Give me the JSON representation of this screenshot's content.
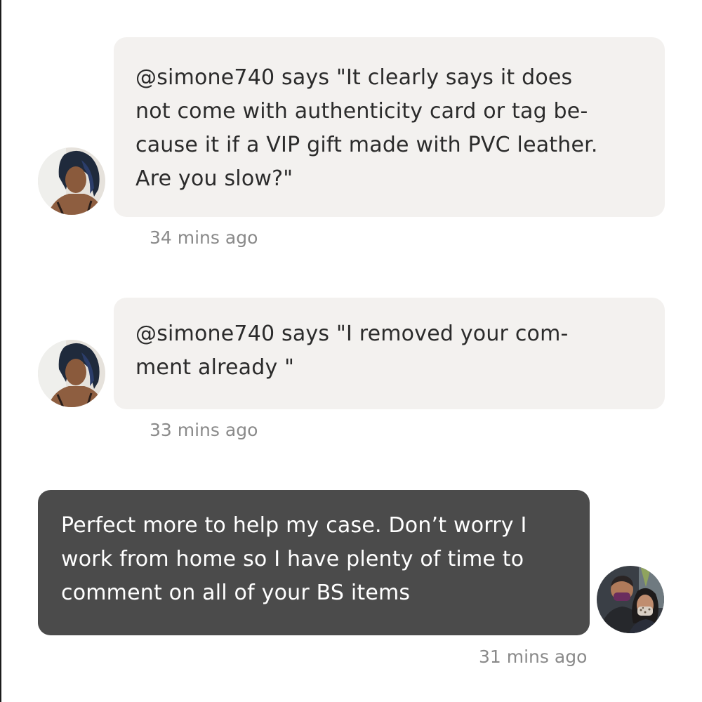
{
  "messages": [
    {
      "sender": "other",
      "text": "@simone740 says \"It clearly says it does\nnot come with authenticity card or tag be-\ncause it if a VIP gift made with PVC leather.\nAre you slow?\"",
      "time": "34 mins ago",
      "avatar": "other-user-avatar"
    },
    {
      "sender": "other",
      "text": "@simone740 says \"I removed your com-\nment already \"",
      "time": "33 mins ago",
      "avatar": "other-user-avatar"
    },
    {
      "sender": "me",
      "text": "Perfect more to help my case. Don’t worry I\nwork from home so I have plenty of time to\ncomment on all of your BS items",
      "time": "31 mins ago",
      "avatar": "current-user-avatar"
    }
  ],
  "colors": {
    "incoming_bubble": "#f3f1ef",
    "outgoing_bubble": "#4b4b4b",
    "timestamp": "#8a8a8a"
  }
}
